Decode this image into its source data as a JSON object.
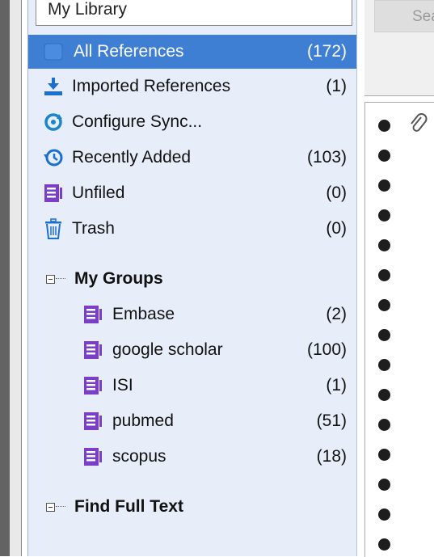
{
  "library": {
    "title": "My Library"
  },
  "sidebar": {
    "items": [
      {
        "label": "All References",
        "count": "(172)"
      },
      {
        "label": "Imported References",
        "count": "(1)"
      },
      {
        "label": "Configure Sync...",
        "count": ""
      },
      {
        "label": "Recently Added",
        "count": "(103)"
      },
      {
        "label": "Unfiled",
        "count": "(0)"
      },
      {
        "label": "Trash",
        "count": "(0)"
      }
    ],
    "groups_header": "My Groups",
    "groups": [
      {
        "label": "Embase",
        "count": "(2)"
      },
      {
        "label": "google scholar",
        "count": "(100)"
      },
      {
        "label": "ISI",
        "count": "(1)"
      },
      {
        "label": "pubmed",
        "count": "(51)"
      },
      {
        "label": "scopus",
        "count": "(18)"
      }
    ],
    "find_full_text": "Find Full Text"
  },
  "toolbar": {
    "search_label": "Search"
  },
  "colors": {
    "selection": "#3f7fd3",
    "group_icon": "#7a3fc6",
    "sidebar_bg": "#e8eef9"
  }
}
